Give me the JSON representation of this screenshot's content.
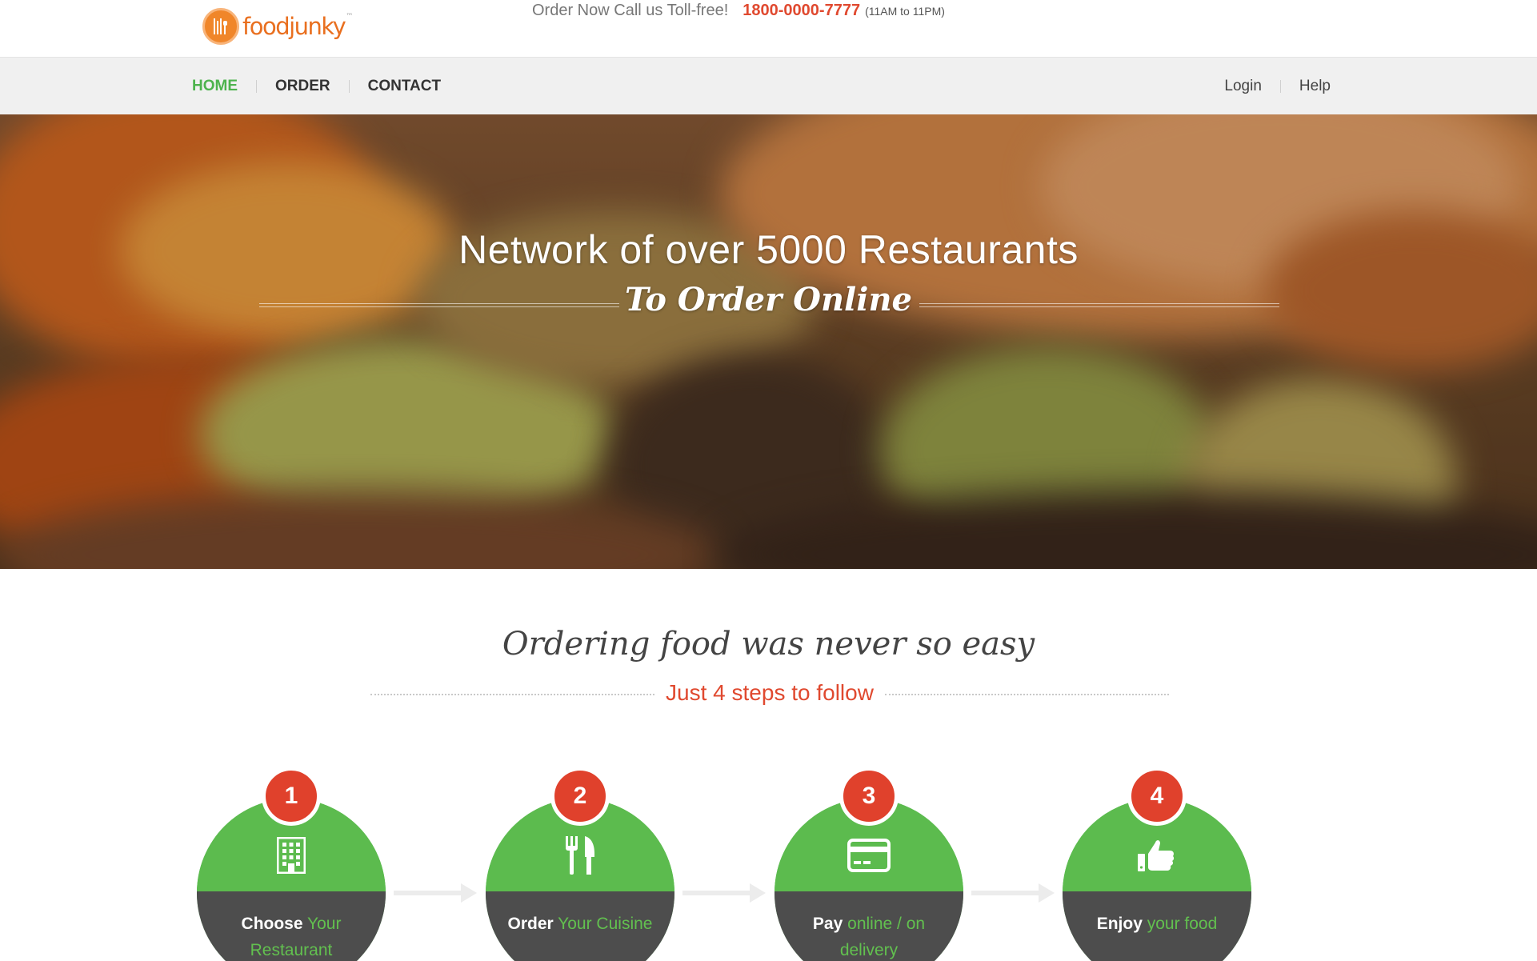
{
  "header": {
    "logo_text": "foodjunky",
    "call_text": "Order Now Call us Toll-free!",
    "phone": "1800-0000-7777",
    "hours": "(11AM to 11PM)"
  },
  "nav": {
    "left": [
      {
        "label": "HOME",
        "active": true
      },
      {
        "label": "ORDER",
        "active": false
      },
      {
        "label": "CONTACT",
        "active": false
      }
    ],
    "right": [
      {
        "label": "Login"
      },
      {
        "label": "Help"
      }
    ]
  },
  "hero": {
    "title": "Network of over 5000 Restaurants",
    "subtitle": "To Order Online"
  },
  "steps_section": {
    "title": "Ordering food was never so easy",
    "subtitle": "Just 4 steps to follow",
    "steps": [
      {
        "number": "1",
        "icon": "building-icon",
        "bold": "Choose",
        "rest": "Your Restaurant"
      },
      {
        "number": "2",
        "icon": "utensils-icon",
        "bold": "Order",
        "rest": "Your Cuisine"
      },
      {
        "number": "3",
        "icon": "credit-card-icon",
        "bold": "Pay",
        "rest": "online / on delivery"
      },
      {
        "number": "4",
        "icon": "thumbs-up-icon",
        "bold": "Enjoy",
        "rest": "your food"
      }
    ]
  },
  "colors": {
    "brand_orange": "#e96f1f",
    "accent_red": "#e0492f",
    "accent_green": "#5cbb4e",
    "dark_gray": "#4d4d4d",
    "nav_bg": "#f0f0f0"
  }
}
